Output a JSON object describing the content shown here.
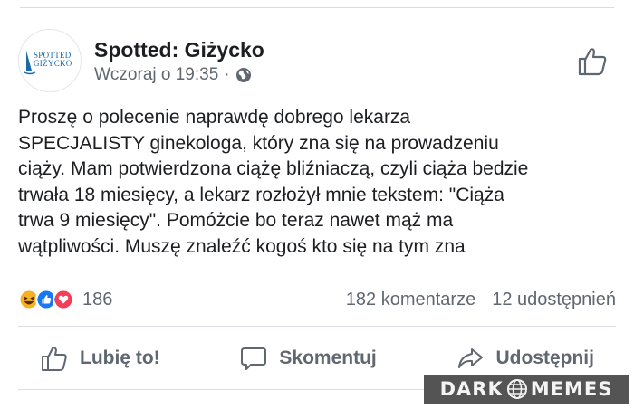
{
  "post": {
    "page_name": "Spotted: Giżycko",
    "timestamp": "Wczoraj o 19:35",
    "separator": "·",
    "avatar_logo_text_line1": "SPOTTED",
    "avatar_logo_text_line2": "GIŻYCKO",
    "text": "Proszę o polecenie naprawdę dobrego lekarza\nSPECJALISTY ginekologa, który zna się na prowadzeniu\nciąży. Mam potwierdzona ciążę bliźniaczą, czyli ciąża bedzie\ntrwała 18 miesięcy, a lekarz rozłożył mnie tekstem: \"Ciąża\ntrwa 9 miesięcy\". Pomóżcie bo teraz nawet mąż ma\nwątpliwości. Muszę znaleźć kogoś kto się na tym zna"
  },
  "stats": {
    "reactions": [
      "haha-icon",
      "like-icon",
      "love-icon"
    ],
    "reaction_count": "186",
    "comments": "182 komentarze",
    "shares": "12 udostępnień"
  },
  "actions": {
    "like": "Lubię to!",
    "comment": "Skomentuj",
    "share": "Udostępnij"
  },
  "watermark": {
    "left": "DARK",
    "right": "MEMES"
  },
  "colors": {
    "text": "#1c1e21",
    "secondary": "#606770",
    "like_blue": "#1877f2",
    "love_red": "#f33e58",
    "haha_yellow": "#f7b125",
    "logo_blue": "#1a6aa8"
  }
}
